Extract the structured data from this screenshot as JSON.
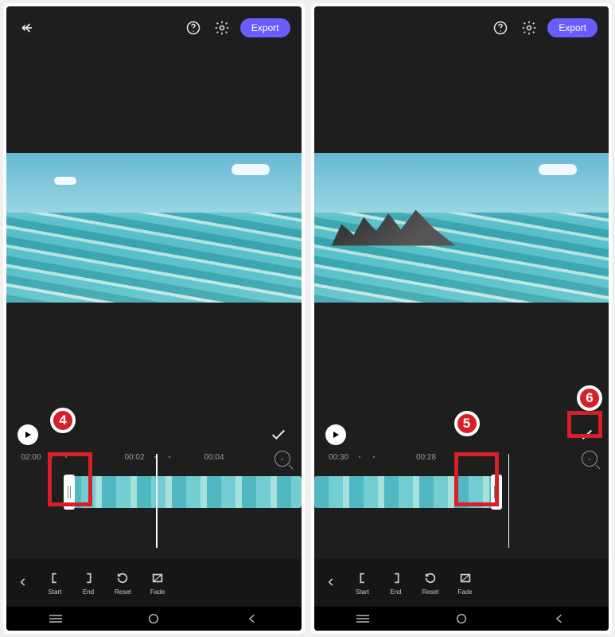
{
  "header": {
    "export_label": "Export"
  },
  "timeline": {
    "left": {
      "t0": "02:00",
      "t1": "00:02",
      "t2": "00:04"
    },
    "right": {
      "t0": "00:30",
      "t1": "00:28"
    },
    "zoom_icon_label": "-"
  },
  "tools": {
    "start": "Start",
    "end": "End",
    "reset": "Reset",
    "fade": "Fade"
  },
  "annotations": {
    "b4": "4",
    "b5": "5",
    "b6": "6"
  }
}
